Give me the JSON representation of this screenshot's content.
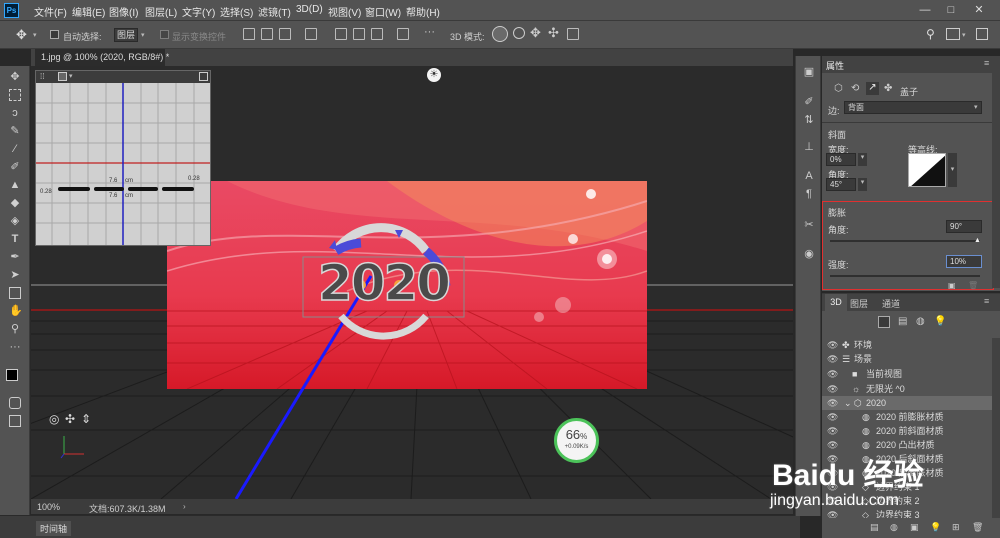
{
  "menubar": {
    "logo": "Ps",
    "items": [
      "文件(F)",
      "编辑(E)",
      "图像(I)",
      "图层(L)",
      "文字(Y)",
      "选择(S)",
      "滤镜(T)",
      "3D(D)",
      "视图(V)",
      "窗口(W)",
      "帮助(H)"
    ]
  },
  "options": {
    "auto_select_label": "自动选择:",
    "auto_select_value": "图层",
    "transform_controls_label": "显示变换控件",
    "mode_label": "3D 模式:",
    "more": "···"
  },
  "document": {
    "tab_title": "1.jpg @ 100% (2020, RGB/8#) *"
  },
  "minimap": {
    "labels": [
      "7.6",
      "cm",
      "7.6",
      "cm",
      "0.28",
      "0.28"
    ]
  },
  "canvas": {
    "text_3d": "2020"
  },
  "status": {
    "zoom": "100%",
    "doc_info": "文档:607.3K/1.38M"
  },
  "timeline": {
    "label": "时间轴"
  },
  "properties": {
    "title": "属性",
    "row_label": "盖子",
    "side_label": "边:",
    "side_value": "背面",
    "bevel_section": "斜面",
    "width_label": "宽度:",
    "width_value": "0%",
    "angle_label": "角度:",
    "angle_value": "45°",
    "contour_label": "等高线:",
    "inflate_section": "膨胀",
    "inflate_angle_label": "角度:",
    "inflate_angle_value": "90°",
    "strength_label": "强度:",
    "strength_value": "10%",
    "angle_slider_level": 0.97,
    "strength_slider_level": 0.1
  },
  "layers_panel": {
    "tabs": [
      "3D",
      "图层",
      "通道"
    ],
    "rows": [
      "环境",
      "场景",
      "当前视图",
      "无限光 ^0",
      "2020",
      "2020 前膨胀材质",
      "2020 前斜面材质",
      "2020 凸出材质",
      "2020 后斜面材质",
      "2020 后膨胀材质",
      "边界约束 1",
      "边界约束 2",
      "边界约束 3"
    ]
  },
  "network": {
    "percent": "66",
    "unit": "%",
    "speed": "+0.09K/s"
  },
  "watermark": {
    "brand": "Baidu 经验",
    "url": "jingyan.baidu.com"
  },
  "colors": {
    "ps_blue": "#31a8ff",
    "panel_bg": "#535353",
    "canvas_bg": "#2b2b2b",
    "accent_red_box": "#e03030",
    "axis_blue": "#1a1aff",
    "net_green": "#4cc35a"
  }
}
